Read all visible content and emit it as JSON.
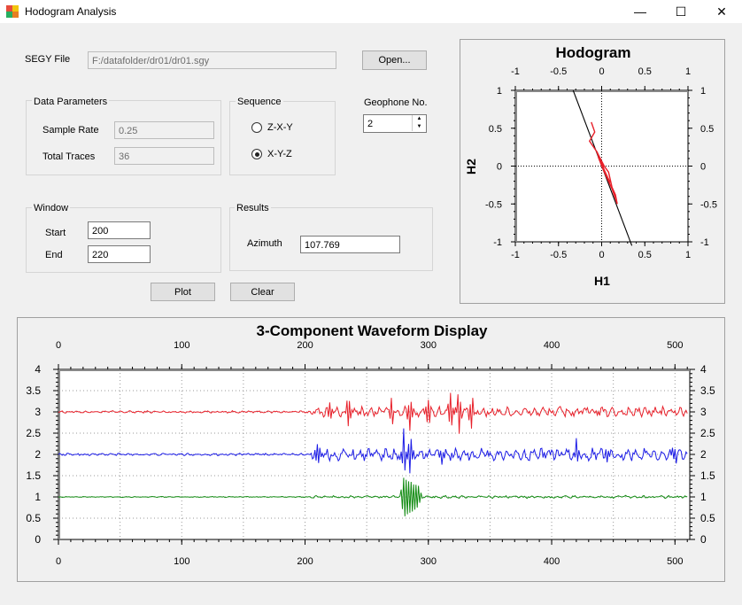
{
  "window": {
    "title": "Hodogram Analysis",
    "minimize": "—",
    "maximize": "☐",
    "close": "✕"
  },
  "segy": {
    "label": "SEGY File",
    "path": "F:/datafolder/dr01/dr01.sgy",
    "open_button": "Open..."
  },
  "data_params": {
    "title": "Data Parameters",
    "sample_rate_label": "Sample Rate",
    "sample_rate": "0.25",
    "total_traces_label": "Total Traces",
    "total_traces": "36"
  },
  "sequence": {
    "title": "Sequence",
    "options": [
      "Z-X-Y",
      "X-Y-Z"
    ],
    "selected": "X-Y-Z"
  },
  "geophone": {
    "label": "Geophone No.",
    "value": "2"
  },
  "window_group": {
    "title": "Window",
    "start_label": "Start",
    "start": "200",
    "end_label": "End",
    "end": "220"
  },
  "results": {
    "title": "Results",
    "azimuth_label": "Azimuth",
    "azimuth": "107.769"
  },
  "actions": {
    "plot": "Plot",
    "clear": "Clear"
  },
  "colors": {
    "red": "#e8202a",
    "blue": "#1c1ce6",
    "green": "#108a10",
    "black": "#000000"
  },
  "chart_data": [
    {
      "type": "scatter",
      "title": "Hodogram",
      "xlabel": "H1",
      "ylabel": "H2",
      "xlim": [
        -1,
        1
      ],
      "ylim": [
        -1,
        1
      ],
      "xticks": [
        "-1",
        "-0.5",
        "0",
        "0.5",
        "1"
      ],
      "yticks": [
        "1",
        "0.5",
        "0",
        "-0.5",
        "-1"
      ],
      "grid": "dotted zero lines",
      "series": [
        {
          "color": "#000000",
          "points": [
            [
              -0.33,
              1.0
            ],
            [
              0.35,
              -1.05
            ]
          ]
        },
        {
          "color": "#e8202a",
          "points": [
            [
              -0.12,
              0.58
            ],
            [
              -0.08,
              0.45
            ],
            [
              -0.14,
              0.33
            ],
            [
              -0.05,
              0.18
            ],
            [
              0.0,
              0.05
            ],
            [
              0.03,
              -0.05
            ],
            [
              0.07,
              -0.15
            ],
            [
              0.1,
              -0.22
            ],
            [
              0.05,
              -0.12
            ],
            [
              0.0,
              0.02
            ],
            [
              -0.06,
              0.2
            ],
            [
              0.03,
              0.0
            ],
            [
              0.08,
              -0.08
            ],
            [
              0.12,
              -0.28
            ],
            [
              0.16,
              -0.38
            ],
            [
              0.18,
              -0.5
            ],
            [
              0.12,
              -0.3
            ],
            [
              0.02,
              -0.05
            ],
            [
              -0.04,
              0.12
            ]
          ]
        }
      ]
    },
    {
      "type": "line",
      "title": "3-Component Waveform Display",
      "xlim": [
        0,
        512
      ],
      "ylim": [
        0,
        4
      ],
      "xticks": [
        "0",
        "100",
        "200",
        "300",
        "400",
        "500"
      ],
      "yticks": [
        "0",
        "0.5",
        "1",
        "1.5",
        "2",
        "2.5",
        "3",
        "3.5",
        "4"
      ],
      "grid": "dotted",
      "series": [
        {
          "color": "#e8202a",
          "baseline": 3.0,
          "x_start": 0,
          "x_end": 510,
          "quiet_amp": 0.03,
          "active_from": 205,
          "active_amp": 0.14,
          "spikes": [
            [
              220,
              0.25
            ],
            [
              235,
              0.35
            ],
            [
              270,
              0.3
            ],
            [
              285,
              0.4
            ],
            [
              300,
              0.35
            ],
            [
              318,
              0.4
            ],
            [
              325,
              0.45
            ],
            [
              335,
              0.4
            ]
          ]
        },
        {
          "color": "#1c1ce6",
          "baseline": 2.0,
          "x_start": 0,
          "x_end": 510,
          "quiet_amp": 0.03,
          "active_from": 205,
          "active_amp": 0.16,
          "spikes": [
            [
              210,
              0.25
            ],
            [
              280,
              0.48
            ],
            [
              285,
              0.42
            ],
            [
              310,
              0.2
            ],
            [
              420,
              0.25
            ],
            [
              445,
              0.22
            ],
            [
              500,
              0.22
            ]
          ]
        },
        {
          "color": "#108a10",
          "baseline": 1.0,
          "x_start": 0,
          "x_end": 510,
          "quiet_amp": 0.012,
          "active_from": 205,
          "active_amp": 0.035,
          "spikes": [
            [
              280,
              0.45
            ],
            [
              283,
              0.4
            ],
            [
              286,
              0.36
            ],
            [
              289,
              0.3
            ],
            [
              292,
              0.25
            ]
          ]
        }
      ]
    }
  ]
}
